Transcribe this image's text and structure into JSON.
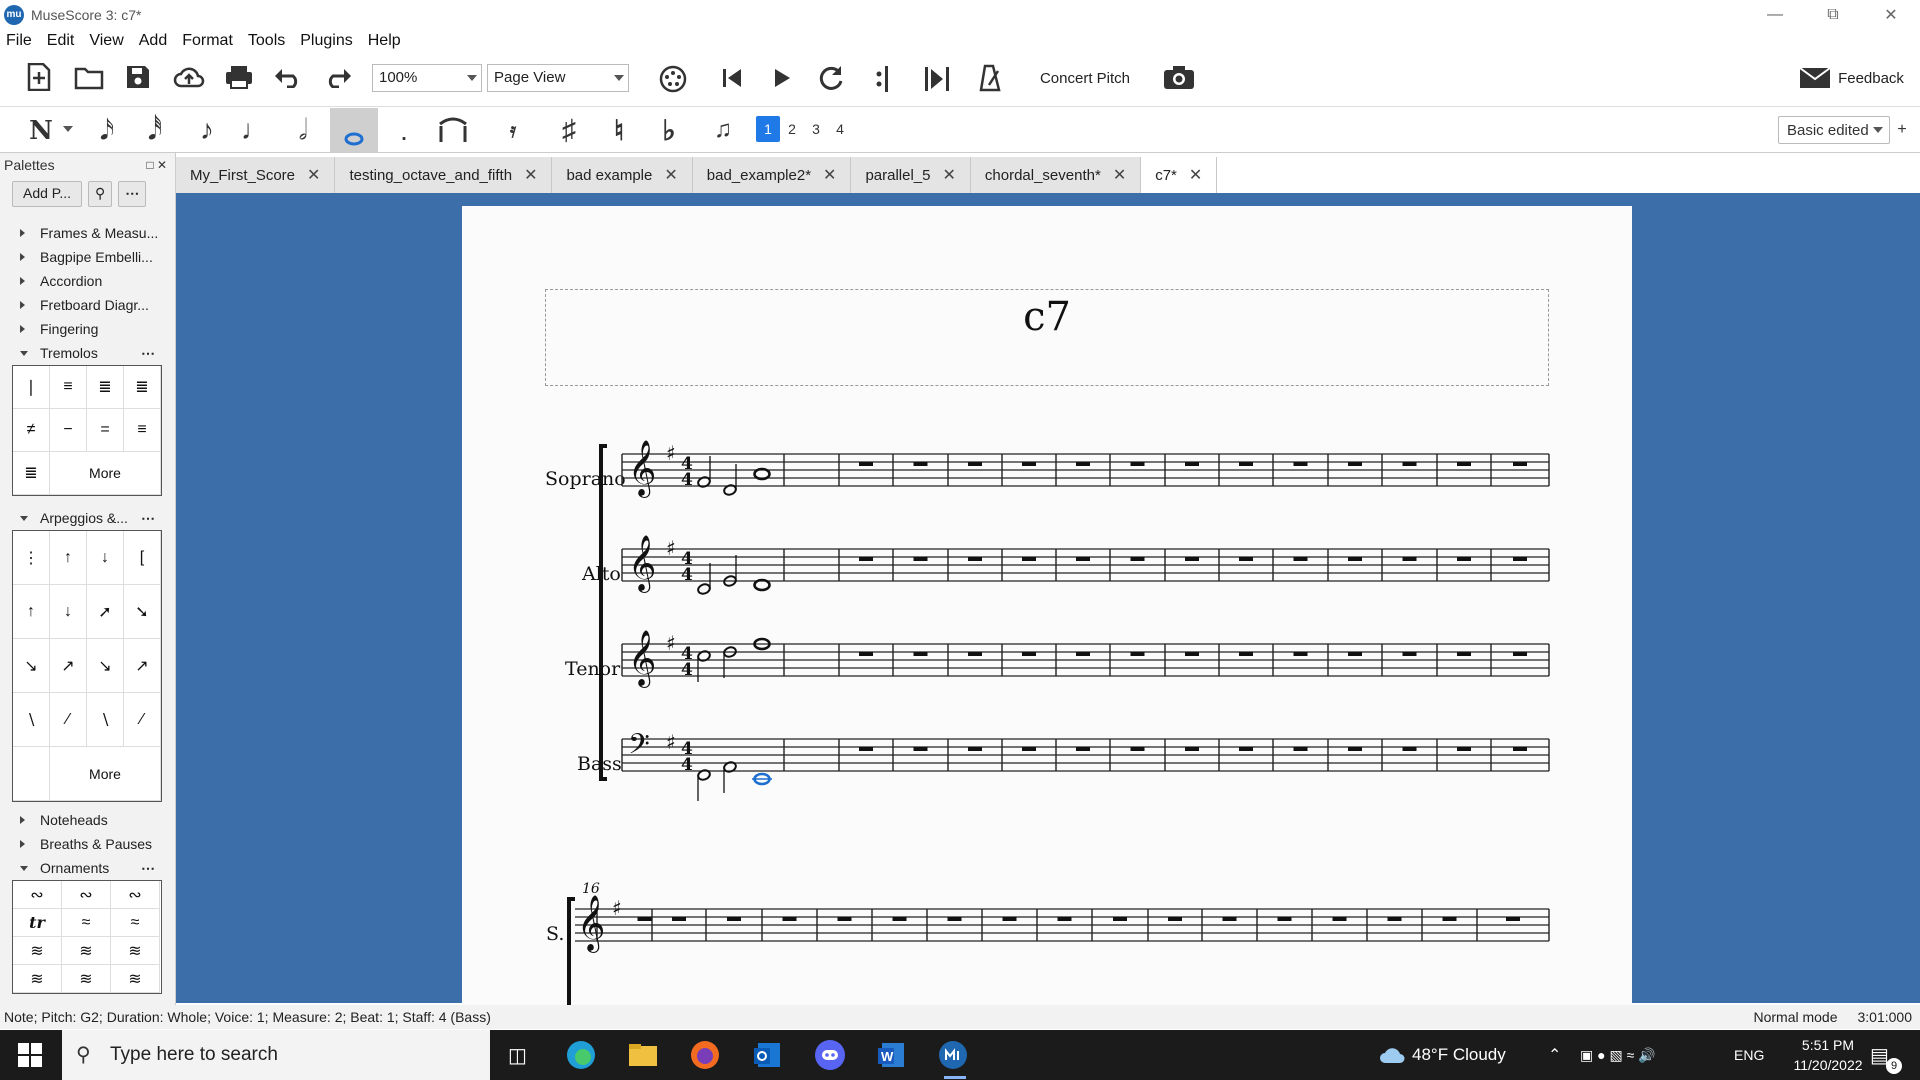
{
  "window": {
    "title": "MuseScore 3: c7*",
    "app_logo": "mu"
  },
  "menu": [
    "File",
    "Edit",
    "View",
    "Add",
    "Format",
    "Tools",
    "Plugins",
    "Help"
  ],
  "toolbar": {
    "zoom": "100%",
    "view_mode": "Page View",
    "concert_pitch": "Concert Pitch",
    "feedback": "Feedback",
    "workspace": "Basic edited",
    "voices": [
      "1",
      "2",
      "3",
      "4"
    ]
  },
  "palettes": {
    "header": "Palettes",
    "add_button": "Add P...",
    "more": "More",
    "items_top": [
      "Frames & Measu...",
      "Bagpipe Embelli...",
      "Accordion",
      "Fretboard Diagr...",
      "Fingering"
    ],
    "tremolos": "Tremolos",
    "arpeggios": "Arpeggios &...",
    "items_mid": [
      "Noteheads",
      "Breaths & Pauses"
    ],
    "ornaments": "Ornaments"
  },
  "tabs": [
    {
      "label": "My_First_Score"
    },
    {
      "label": "testing_octave_and_fifth"
    },
    {
      "label": "bad example"
    },
    {
      "label": "bad_example2*"
    },
    {
      "label": "parallel_5"
    },
    {
      "label": "chordal_seventh*"
    },
    {
      "label": "c7*"
    }
  ],
  "score": {
    "title": "c7",
    "staves": [
      "Soprano",
      "Alto",
      "Tenor",
      "Bass"
    ],
    "system2_label": "S.",
    "measure_number": "16",
    "time_signature": "4/4"
  },
  "status": {
    "left": "Note; Pitch: G2; Duration: Whole; Voice: 1;  Measure: 2; Beat: 1; Staff: 4 (Bass)",
    "mode": "Normal mode",
    "time": "3:01:000"
  },
  "taskbar": {
    "search_placeholder": "Type here to search",
    "weather": "48°F  Cloudy",
    "lang": "ENG",
    "time": "5:51 PM",
    "date": "11/20/2022",
    "notifications": "9"
  }
}
